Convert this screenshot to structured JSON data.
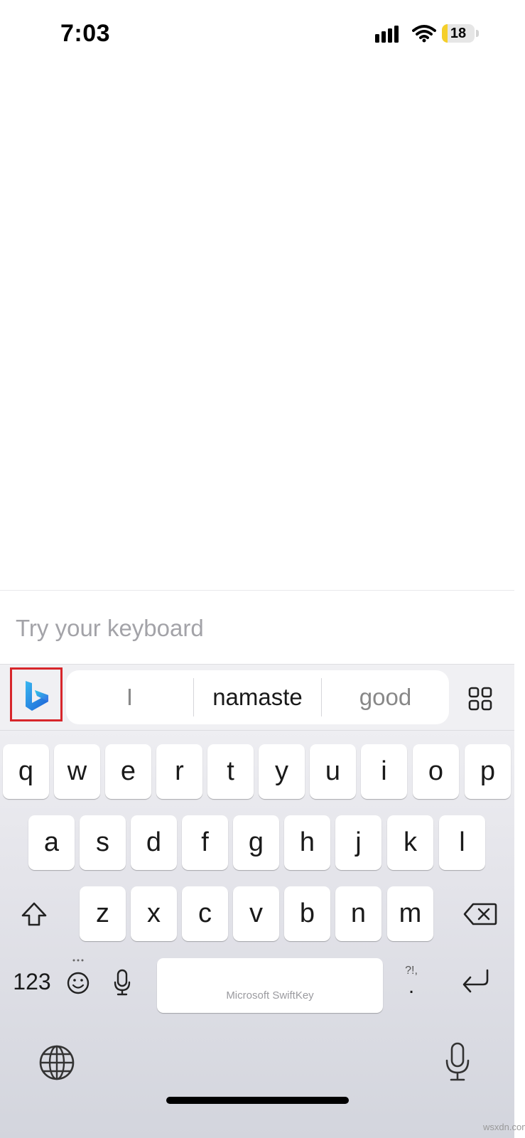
{
  "status_bar": {
    "time": "7:03",
    "battery_level": "18",
    "battery_fraction": 0.18
  },
  "input": {
    "placeholder": "Try your keyboard",
    "value": ""
  },
  "toolbar": {
    "bing_icon": "bing-logo-icon",
    "apps_icon": "grid-icon",
    "suggestions": [
      "I",
      "namaste",
      "good"
    ]
  },
  "keyboard": {
    "row1": [
      "q",
      "w",
      "e",
      "r",
      "t",
      "y",
      "u",
      "i",
      "o",
      "p"
    ],
    "row2": [
      "a",
      "s",
      "d",
      "f",
      "g",
      "h",
      "j",
      "k",
      "l"
    ],
    "row3": [
      "z",
      "x",
      "c",
      "v",
      "b",
      "n",
      "m"
    ],
    "numbers_label": "123",
    "space_label": "Microsoft SwiftKey",
    "punctuation_top": "?!,",
    "punctuation_main": "."
  },
  "colors": {
    "highlight_box": "#d7262b",
    "battery": "#f5cf2a"
  },
  "watermark": "wsxdn.com"
}
